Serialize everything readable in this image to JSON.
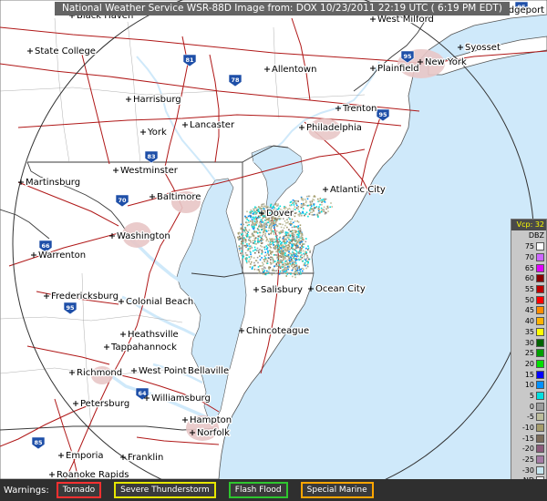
{
  "title": "National Weather Service WSR-88D Image from: DOX 10/23/2011  22:19 UTC ( 6:19 PM EDT)",
  "colors": {
    "water": "#cfe9fa",
    "land": "#ffffff",
    "roads": "#b01818",
    "boundaries": "#3a3a3a",
    "range_ring": "#333333"
  },
  "cities": [
    {
      "name": "Bridgeport"
    },
    {
      "name": "West Milford"
    },
    {
      "name": "Black Haven"
    },
    {
      "name": "State College"
    },
    {
      "name": "Allentown"
    },
    {
      "name": "Plainfield"
    },
    {
      "name": "Syosset"
    },
    {
      "name": "New York"
    },
    {
      "name": "Harrisburg"
    },
    {
      "name": "Trenton"
    },
    {
      "name": "Lancaster"
    },
    {
      "name": "Philadelphia"
    },
    {
      "name": "York"
    },
    {
      "name": "Westminster"
    },
    {
      "name": "Martinsburg"
    },
    {
      "name": "Atlantic City"
    },
    {
      "name": "Baltimore"
    },
    {
      "name": "Dover"
    },
    {
      "name": "Washington"
    },
    {
      "name": "Warrenton"
    },
    {
      "name": "Salisbury"
    },
    {
      "name": "Ocean City"
    },
    {
      "name": "Fredericksburg"
    },
    {
      "name": "Colonial Beach"
    },
    {
      "name": "Chincoteague"
    },
    {
      "name": "Heathsville"
    },
    {
      "name": "Tappahannock"
    },
    {
      "name": "West Point"
    },
    {
      "name": "Bellaville"
    },
    {
      "name": "Richmond"
    },
    {
      "name": "Williamsburg"
    },
    {
      "name": "Petersburg"
    },
    {
      "name": "Hampton"
    },
    {
      "name": "Norfolk"
    },
    {
      "name": "Emporia"
    },
    {
      "name": "Franklin"
    },
    {
      "name": "Roanoke Rapids"
    }
  ],
  "highways": [
    {
      "label": "81"
    },
    {
      "label": "78"
    },
    {
      "label": "95"
    },
    {
      "label": "95"
    },
    {
      "label": "83"
    },
    {
      "label": "70"
    },
    {
      "label": "66"
    },
    {
      "label": "95"
    },
    {
      "label": "64"
    },
    {
      "label": "85"
    },
    {
      "label": "95"
    }
  ],
  "legend": {
    "header": "Vcp: 32",
    "unit": "DBZ",
    "levels": [
      {
        "value": "75",
        "color": "#ffffff"
      },
      {
        "value": "70",
        "color": "#cc66ff"
      },
      {
        "value": "65",
        "color": "#e000ff"
      },
      {
        "value": "60",
        "color": "#8b0000"
      },
      {
        "value": "55",
        "color": "#c00000"
      },
      {
        "value": "50",
        "color": "#ff0000"
      },
      {
        "value": "45",
        "color": "#ff8c00"
      },
      {
        "value": "40",
        "color": "#ffb300"
      },
      {
        "value": "35",
        "color": "#ffff00"
      },
      {
        "value": "30",
        "color": "#006400"
      },
      {
        "value": "25",
        "color": "#00a000"
      },
      {
        "value": "20",
        "color": "#00e000"
      },
      {
        "value": "15",
        "color": "#0000ff"
      },
      {
        "value": "10",
        "color": "#0090ff"
      },
      {
        "value": "5",
        "color": "#00e0e0"
      },
      {
        "value": "0",
        "color": "#9c9c9c"
      },
      {
        "value": "-5",
        "color": "#bdbd9c"
      },
      {
        "value": "-10",
        "color": "#a59c6b"
      },
      {
        "value": "-15",
        "color": "#7b6b5a"
      },
      {
        "value": "-20",
        "color": "#8c5a7b"
      },
      {
        "value": "-25",
        "color": "#a57ba5"
      },
      {
        "value": "-30",
        "color": "#c6e6f0"
      },
      {
        "value": "ND",
        "color": "#ffffff"
      }
    ]
  },
  "warnings": {
    "label": "Warnings:",
    "items": [
      {
        "label": "Tornado",
        "color": "#ff3030"
      },
      {
        "label": "Severe Thunderstorm",
        "color": "#e6e600"
      },
      {
        "label": "Flash Flood",
        "color": "#2ec62e"
      },
      {
        "label": "Special Marine",
        "color": "#ffa500"
      }
    ]
  }
}
